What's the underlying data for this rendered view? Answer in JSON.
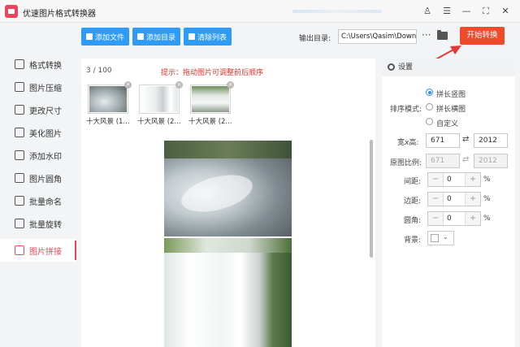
{
  "app": {
    "title": "优速图片格式转换器"
  },
  "sidebar": {
    "items": [
      {
        "label": "格式转换"
      },
      {
        "label": "图片压缩"
      },
      {
        "label": "更改尺寸"
      },
      {
        "label": "美化图片"
      },
      {
        "label": "添加水印"
      },
      {
        "label": "图片圆角"
      },
      {
        "label": "批量命名"
      },
      {
        "label": "批量旋转"
      },
      {
        "label": "图片拼接"
      }
    ],
    "active_index": 8
  },
  "toolbar": {
    "add_file": "添加文件",
    "add_dir": "添加目录",
    "clear_list": "清除列表",
    "output_label": "输出目录:",
    "output_path": "C:\\Users\\Qasim\\Downlc",
    "more": "···",
    "start": "开始转换"
  },
  "main": {
    "count": "3 / 100",
    "hint": "提示：拖动图片可调整前后顺序",
    "thumbs": [
      {
        "caption": "十大风景 (1..."
      },
      {
        "caption": "十大风景 (2..."
      },
      {
        "caption": "十大风景 (2..."
      }
    ]
  },
  "settings": {
    "title": "设置",
    "sort_label": "排序模式:",
    "options": [
      "拼长竖图",
      "拼长横图",
      "自定义"
    ],
    "selected_option": 0,
    "size_label": "宽x高:",
    "width": "671",
    "height": "2012",
    "ratio_label": "原图比例:",
    "ratio_w": "671",
    "ratio_h": "2012",
    "spacing_label": "间距:",
    "spacing": "0",
    "margin_label": "边距:",
    "margin": "0",
    "radius_label": "圆角:",
    "radius": "0",
    "bg_label": "背景:",
    "pct": "%",
    "minus": "−",
    "plus": "+"
  },
  "colors": {
    "accent": "#e8485b",
    "blue": "#2e9cf6",
    "start": "#ef4a2b",
    "hint": "#e0322b"
  }
}
